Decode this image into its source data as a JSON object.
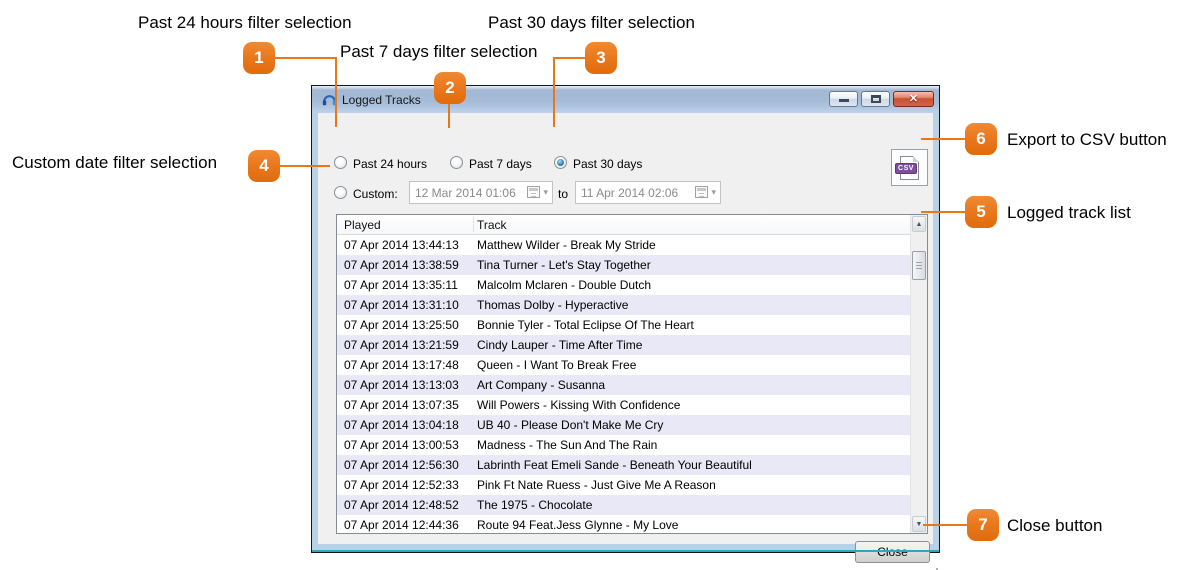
{
  "annotations": {
    "badge_color": "#e87817",
    "items": [
      {
        "number": "1",
        "label": "Past 24 hours filter selection"
      },
      {
        "number": "2",
        "label": "Past 7 days filter selection"
      },
      {
        "number": "3",
        "label": "Past 30 days filter selection"
      },
      {
        "number": "4",
        "label": "Custom date filter selection"
      },
      {
        "number": "5",
        "label": "Logged track list"
      },
      {
        "number": "6",
        "label": "Export to CSV button"
      },
      {
        "number": "7",
        "label": "Close button"
      }
    ]
  },
  "dialog": {
    "title": "Logged Tracks",
    "filters": {
      "past24": "Past 24 hours",
      "past7": "Past 7 days",
      "past30": "Past 30 days",
      "selected": "Past 30 days",
      "custom": "Custom:",
      "from_value": "12 Mar 2014 01:06",
      "to_label": "to",
      "to_value": "11 Apr 2014 02:06"
    },
    "csv_button": {
      "icon_label": "CSV"
    },
    "table": {
      "columns": [
        "Played",
        "Track"
      ],
      "rows": [
        [
          "07 Apr 2014 13:44:13",
          "Matthew Wilder - Break My Stride"
        ],
        [
          "07 Apr 2014 13:38:59",
          "Tina Turner - Let's Stay Together"
        ],
        [
          "07 Apr 2014 13:35:11",
          "Malcolm Mclaren - Double Dutch"
        ],
        [
          "07 Apr 2014 13:31:10",
          "Thomas Dolby - Hyperactive"
        ],
        [
          "07 Apr 2014 13:25:50",
          "Bonnie Tyler - Total Eclipse Of The Heart"
        ],
        [
          "07 Apr 2014 13:21:59",
          "Cindy Lauper - Time After Time"
        ],
        [
          "07 Apr 2014 13:17:48",
          "Queen - I Want To Break Free"
        ],
        [
          "07 Apr 2014 13:13:03",
          "Art Company - Susanna"
        ],
        [
          "07 Apr 2014 13:07:35",
          "Will Powers - Kissing With Confidence"
        ],
        [
          "07 Apr 2014 13:04:18",
          "UB 40 - Please Don't Make Me Cry"
        ],
        [
          "07 Apr 2014 13:00:53",
          "Madness - The Sun And The Rain"
        ],
        [
          "07 Apr 2014 12:56:30",
          "Labrinth Feat Emeli Sande - Beneath Your Beautiful"
        ],
        [
          "07 Apr 2014 12:52:33",
          "Pink Ft Nate Ruess - Just Give Me A Reason"
        ],
        [
          "07 Apr 2014 12:48:52",
          "The 1975 - Chocolate"
        ],
        [
          "07 Apr 2014 12:44:36",
          "Route 94 Feat.Jess Glynne - My Love"
        ]
      ]
    },
    "close_label": "Close"
  },
  "icons": {
    "close_glyph": "✕",
    "scroll_up": "▲",
    "scroll_down": "▼",
    "dropdown_arrow": "▾"
  }
}
